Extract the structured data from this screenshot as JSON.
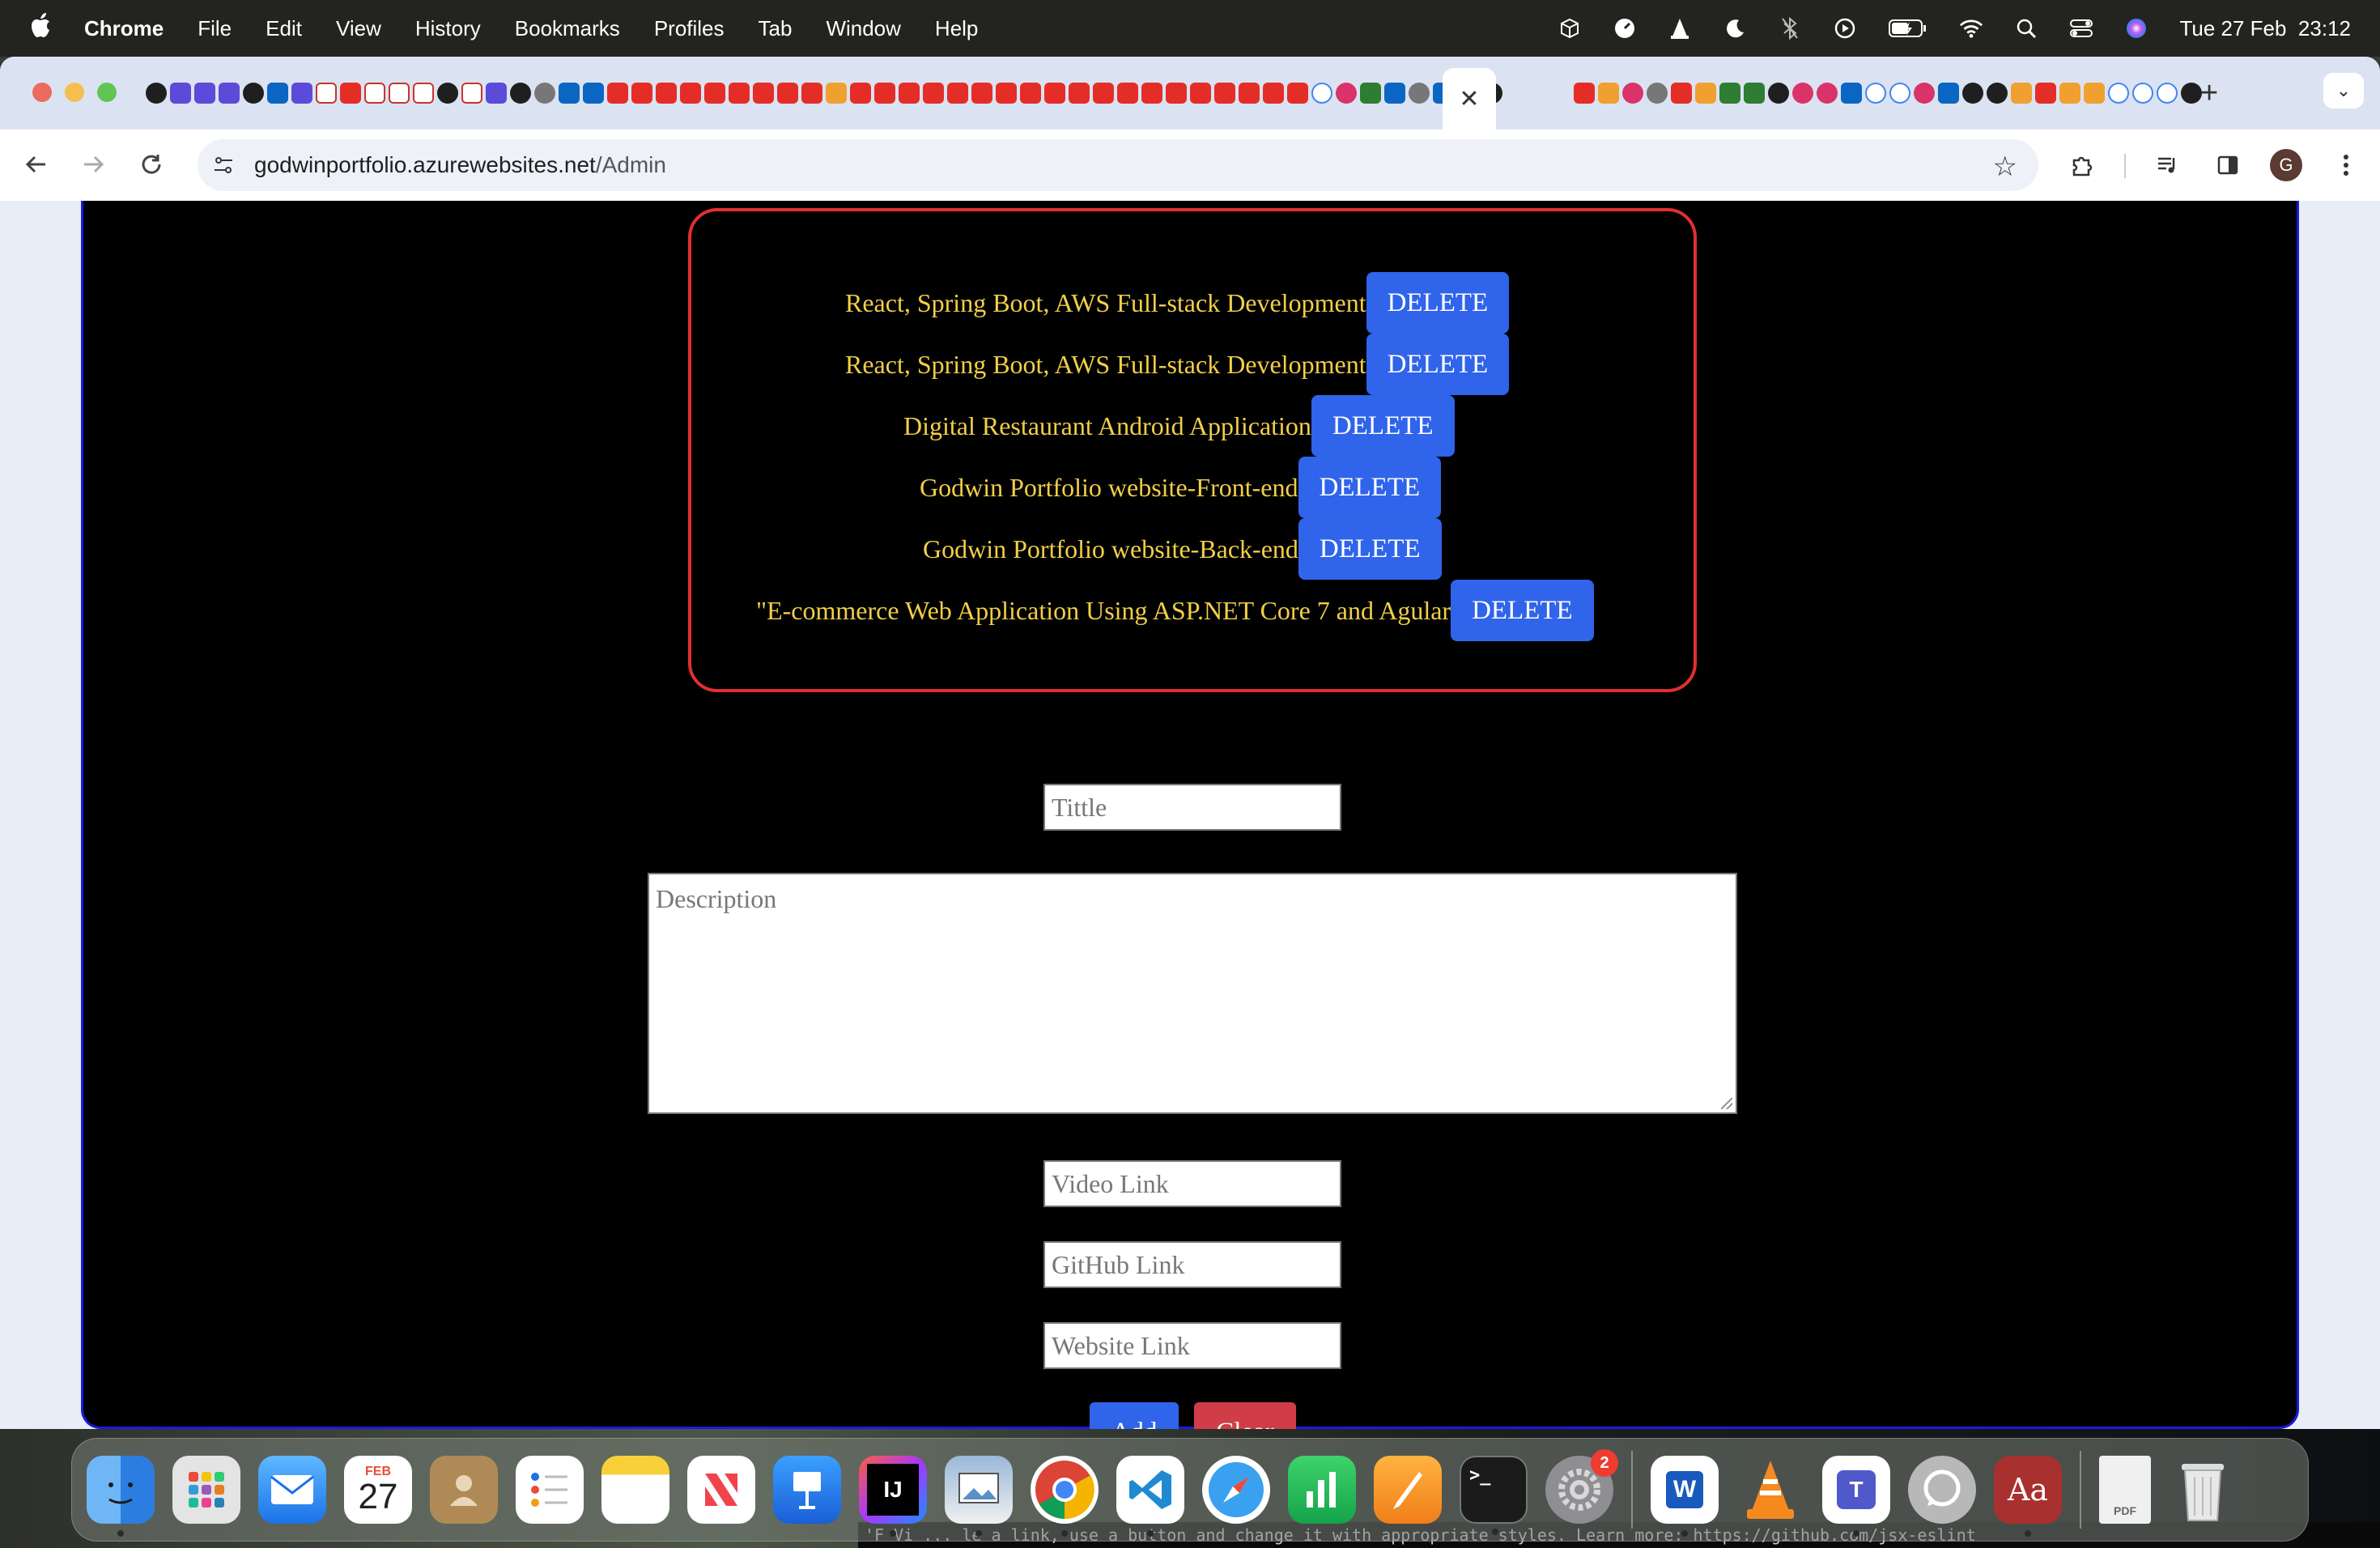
{
  "menubar": {
    "app_name": "Chrome",
    "menus": [
      "File",
      "Edit",
      "View",
      "History",
      "Bookmarks",
      "Profiles",
      "Tab",
      "Window",
      "Help"
    ],
    "clock": "Tue 27 Feb  23:12",
    "status_icons": [
      "cube-icon",
      "speed-icon",
      "vlc-icon",
      "moon-icon",
      "bluetooth-icon",
      "play-icon",
      "battery-icon",
      "wifi-icon",
      "spotlight-icon",
      "control-center-icon",
      "siri-icon"
    ]
  },
  "browser": {
    "active_tab_close": "✕",
    "new_tab": "+",
    "tab_menu": "⌄",
    "url_host": "godwinportfolio.azurewebsites.net",
    "url_path": "/Admin",
    "profile_initial": "G"
  },
  "projects": {
    "items": [
      {
        "title": "React, Spring Boot, AWS Full-stack Development",
        "button": "DELETE"
      },
      {
        "title": "React, Spring Boot, AWS Full-stack Development",
        "button": "DELETE"
      },
      {
        "title": "Digital Restaurant Android Application",
        "button": "DELETE"
      },
      {
        "title": "Godwin Portfolio website-Front-end",
        "button": "DELETE"
      },
      {
        "title": "Godwin Portfolio website-Back-end",
        "button": "DELETE"
      },
      {
        "title": "\"E-commerce Web Application Using ASP.NET Core 7 and Agular",
        "button": "DELETE"
      }
    ]
  },
  "form": {
    "title_placeholder": "Tittle",
    "description_placeholder": "Description",
    "video_placeholder": "Video Link",
    "github_placeholder": "GitHub Link",
    "website_placeholder": "Website Link",
    "add_label": "Add",
    "clear_label": "Clear",
    "add_color": "#2f64eb",
    "clear_color": "#d13d47"
  },
  "dock": {
    "calendar_month": "FEB",
    "calendar_day": "27",
    "settings_badge": "2",
    "intellij_label": "IJ",
    "word_label": "W",
    "teams_label": "T",
    "dictionary_label": "Aa",
    "terminal_label": ">_",
    "pdf_label": "PDF"
  },
  "terminal_peek": "'F Vi              ... le a link, use a button and change it with appropriate styles. Learn more: https://github.com/jsx-eslint"
}
